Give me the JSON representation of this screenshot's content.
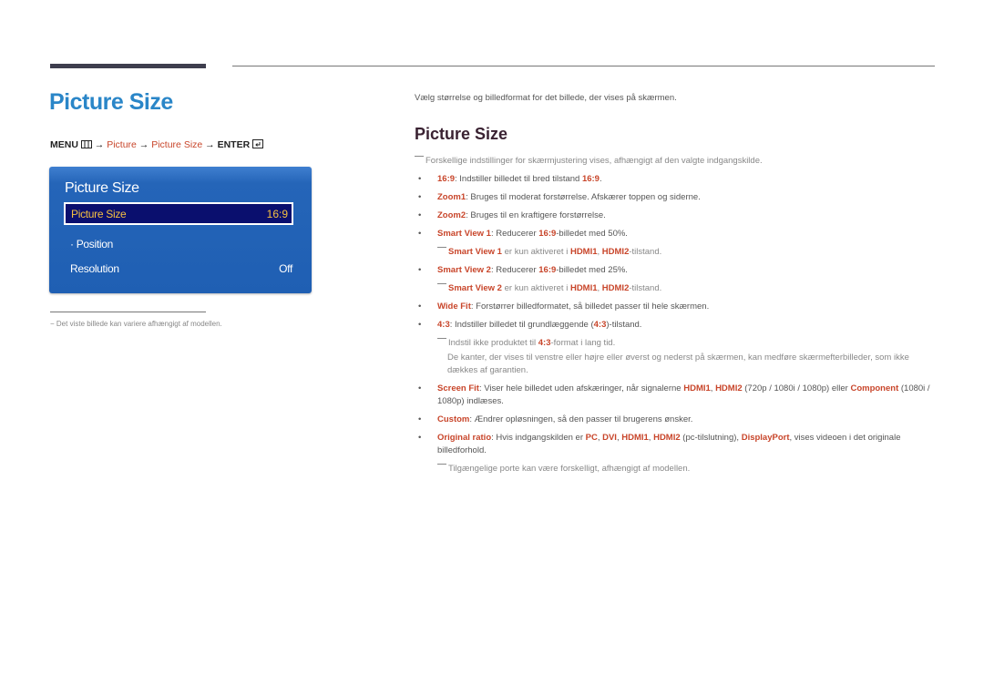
{
  "page": {
    "title": "Picture Size",
    "menu_path": {
      "menu": "MENU",
      "menu_icon": "menu-grid-icon",
      "arrow": "→",
      "step1": "Picture",
      "step2": "Picture Size",
      "enter": "ENTER",
      "enter_icon": "enter-icon"
    },
    "footnote": "−  Det viste billede kan variere afhængigt af modellen."
  },
  "osd": {
    "title": "Picture Size",
    "selected": {
      "label": "Picture Size",
      "value": "16:9"
    },
    "position": "· Position",
    "resolution": {
      "label": "Resolution",
      "value": "Off"
    }
  },
  "content": {
    "intro": "Vælg størrelse og billedformat for det billede, der vises på skærmen.",
    "heading": "Picture Size",
    "note_top": "Forskellige indstillinger for skærmjustering vises, afhængigt af den valgte indgangskilde.",
    "items": {
      "i169": {
        "key": "16:9",
        "t1": ": Indstiller billedet til bred tilstand ",
        "k2": "16:9",
        "t2": "."
      },
      "zoom1": {
        "key": "Zoom1",
        "t1": ": Bruges til moderat forstørrelse. Afskærer toppen og siderne."
      },
      "zoom2": {
        "key": "Zoom2",
        "t1": ": Bruges til en kraftigere forstørrelse."
      },
      "sv1": {
        "key": "Smart View 1",
        "t1": ": Reducerer ",
        "k2": "16:9",
        "t2": "-billedet med 50%."
      },
      "sv1_note": {
        "k1": "Smart View 1",
        "t1": " er kun aktiveret i ",
        "k2": "HDMI1",
        "t2": ", ",
        "k3": "HDMI2",
        "t3": "-tilstand."
      },
      "sv2": {
        "key": "Smart View 2",
        "t1": ": Reducerer ",
        "k2": "16:9",
        "t2": "-billedet med 25%."
      },
      "sv2_note": {
        "k1": "Smart View 2",
        "t1": "  er kun aktiveret i ",
        "k2": "HDMI1",
        "t2": ", ",
        "k3": "HDMI2",
        "t3": "-tilstand."
      },
      "widefit": {
        "key": "Wide Fit",
        "t1": ": Forstørrer billedformatet, så billedet passer til hele skærmen."
      },
      "i43": {
        "key": "4:3",
        "t1": ": Indstiller billedet til grundlæggende (",
        "k2": "4:3",
        "t2": ")-tilstand."
      },
      "i43_note": {
        "t0": "Indstil ikke produktet til ",
        "k1": "4:3",
        "t1": "-format i lang tid."
      },
      "i43_cont": "De kanter, der vises til venstre eller højre eller øverst og nederst på skærmen, kan medføre skærmefterbilleder, som ikke dækkes af garantien.",
      "screenfit": {
        "key": "Screen Fit",
        "t1": ": Viser hele billedet uden afskæringer, når signalerne ",
        "k2": "HDMI1",
        "t2": ", ",
        "k3": "HDMI2",
        "t3": " (720p / 1080i / 1080p) eller ",
        "k4": "Component",
        "t4": " (1080i / 1080p) indlæses."
      },
      "custom": {
        "key": "Custom",
        "t1": ": Ændrer opløsningen, så den passer til brugerens ønsker."
      },
      "original": {
        "key": "Original ratio",
        "t1": ": Hvis indgangskilden er ",
        "k2": "PC",
        "t2": ", ",
        "k3": "DVI",
        "t3": ", ",
        "k4": "HDMI1",
        "t4": ", ",
        "k5": "HDMI2",
        "t5": " (pc-tilslutning), ",
        "k6": "DisplayPort",
        "t6": ", vises videoen i det originale billedforhold."
      },
      "ports_note": "Tilgængelige porte kan være forskelligt, afhængigt af modellen."
    }
  },
  "colors": {
    "title_blue": "#2a86c8",
    "highlight": "#c8452a",
    "osd_blue": "#1f5fb3",
    "osd_selected": "#0a0f6e",
    "osd_selected_text": "#f5c042"
  }
}
